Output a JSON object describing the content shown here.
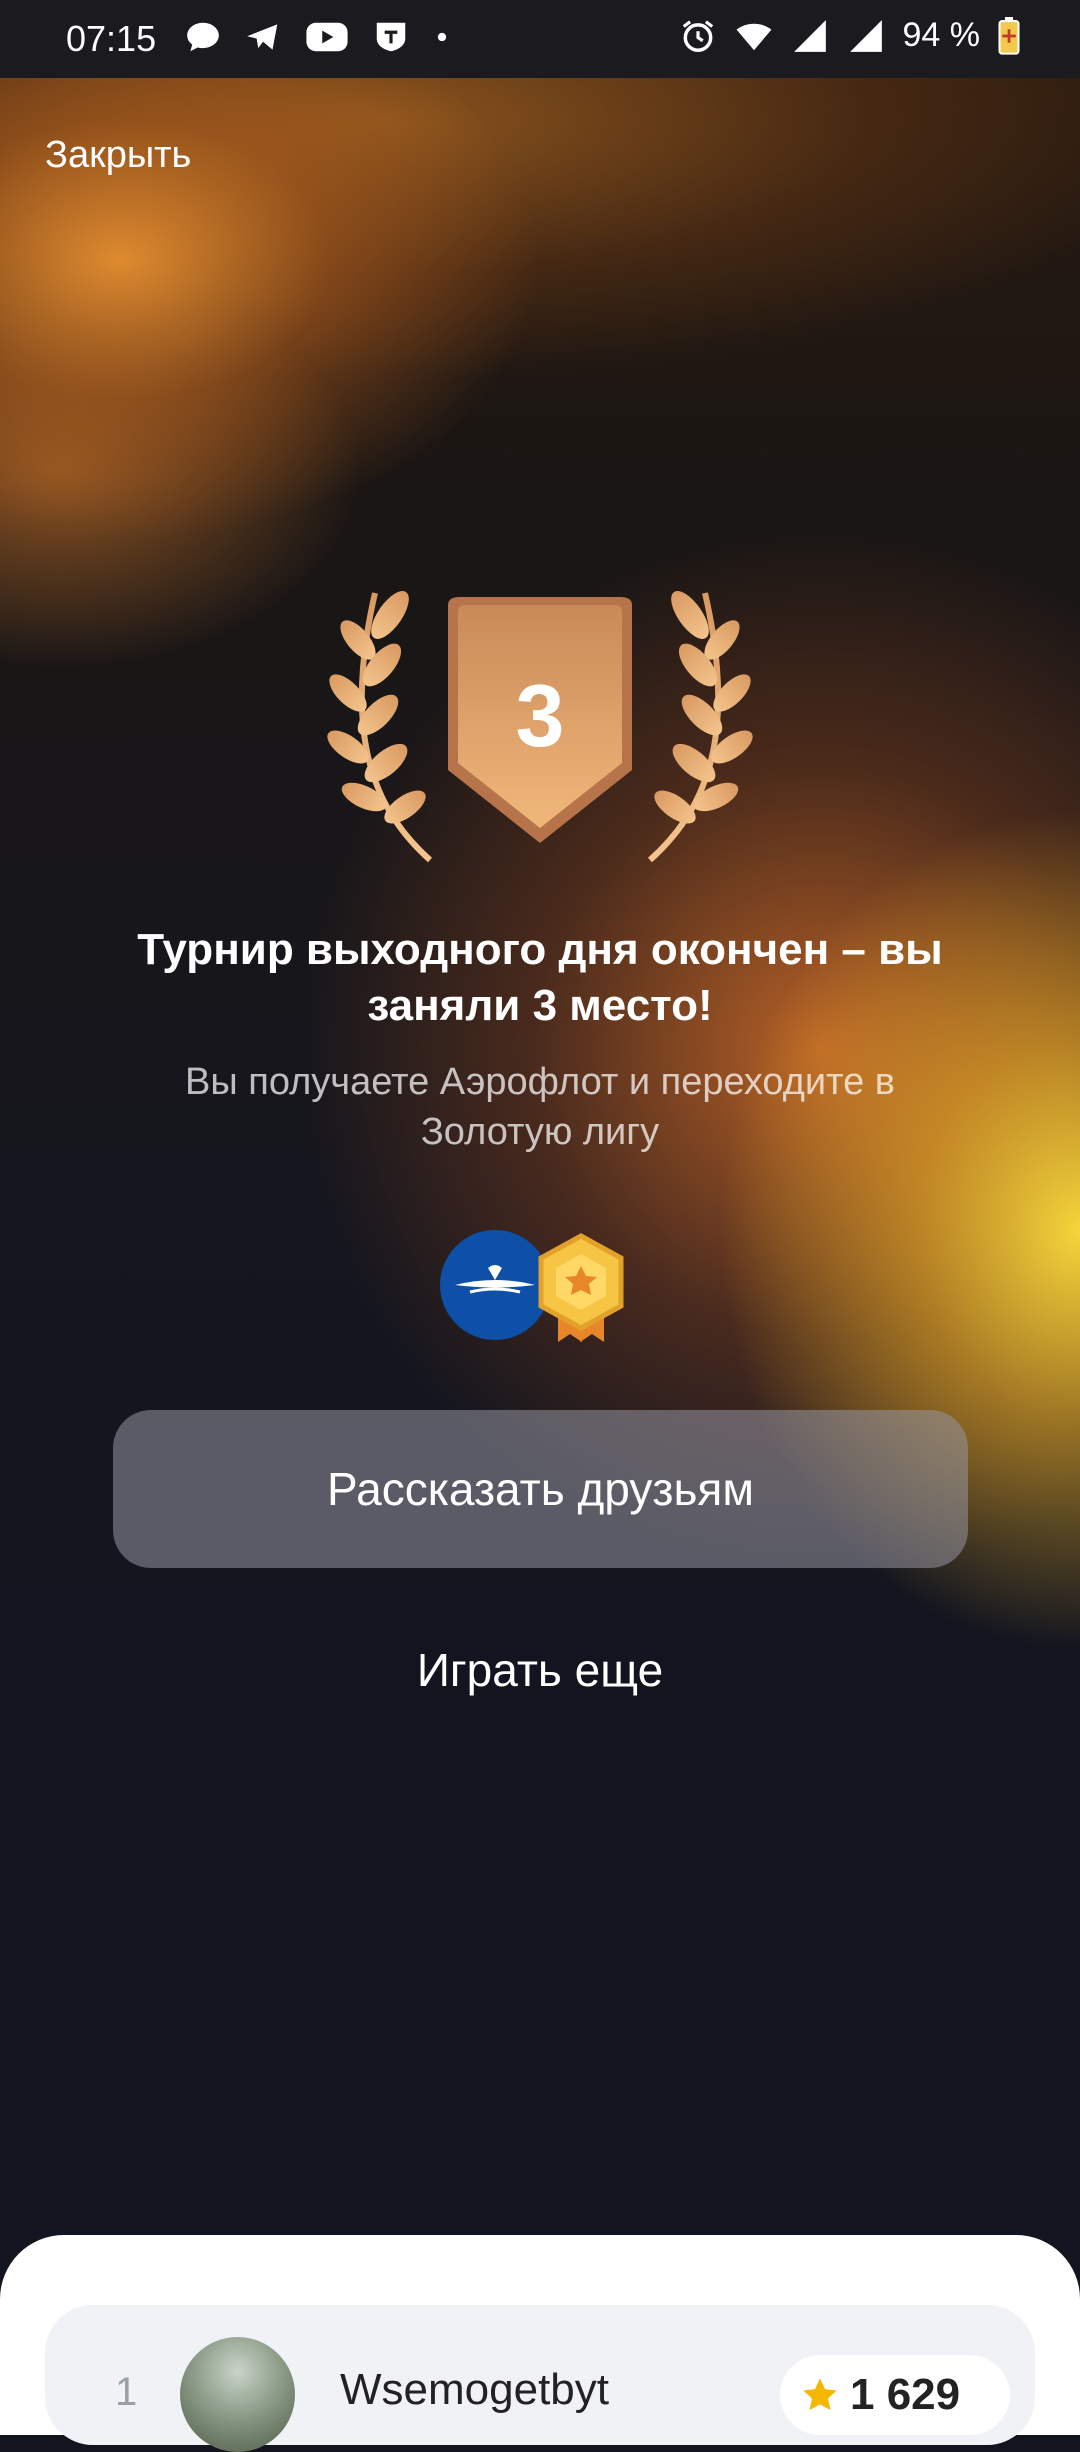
{
  "status_bar": {
    "time": "07:15",
    "battery": "94 %",
    "left_icons": [
      "chat-bubble-icon",
      "telegram-icon",
      "youtube-icon",
      "tinkoff-icon",
      "dot-icon"
    ],
    "right_icons": [
      "alarm-icon",
      "wifi-icon",
      "signal-icon",
      "signal-icon",
      "battery-icon"
    ]
  },
  "header": {
    "close_label": "Закрыть"
  },
  "result": {
    "place": "3",
    "title": "Турнир выходного дня окончен – вы заняли 3 место!",
    "subtitle": "Вы получаете Аэрофлот и переходите в Золотую лигу"
  },
  "rewards": [
    "aeroflot-logo",
    "gold-league-badge"
  ],
  "actions": {
    "share_label": "Рассказать друзьям",
    "play_again_label": "Играть еще"
  },
  "leaderboard": {
    "rows": [
      {
        "rank": "1",
        "name": "Wsemogetbyt",
        "score": "1 629"
      }
    ]
  },
  "colors": {
    "accent_bronze": "#d9935a",
    "glow_yellow": "#ffd83a",
    "background": "#12151f"
  }
}
